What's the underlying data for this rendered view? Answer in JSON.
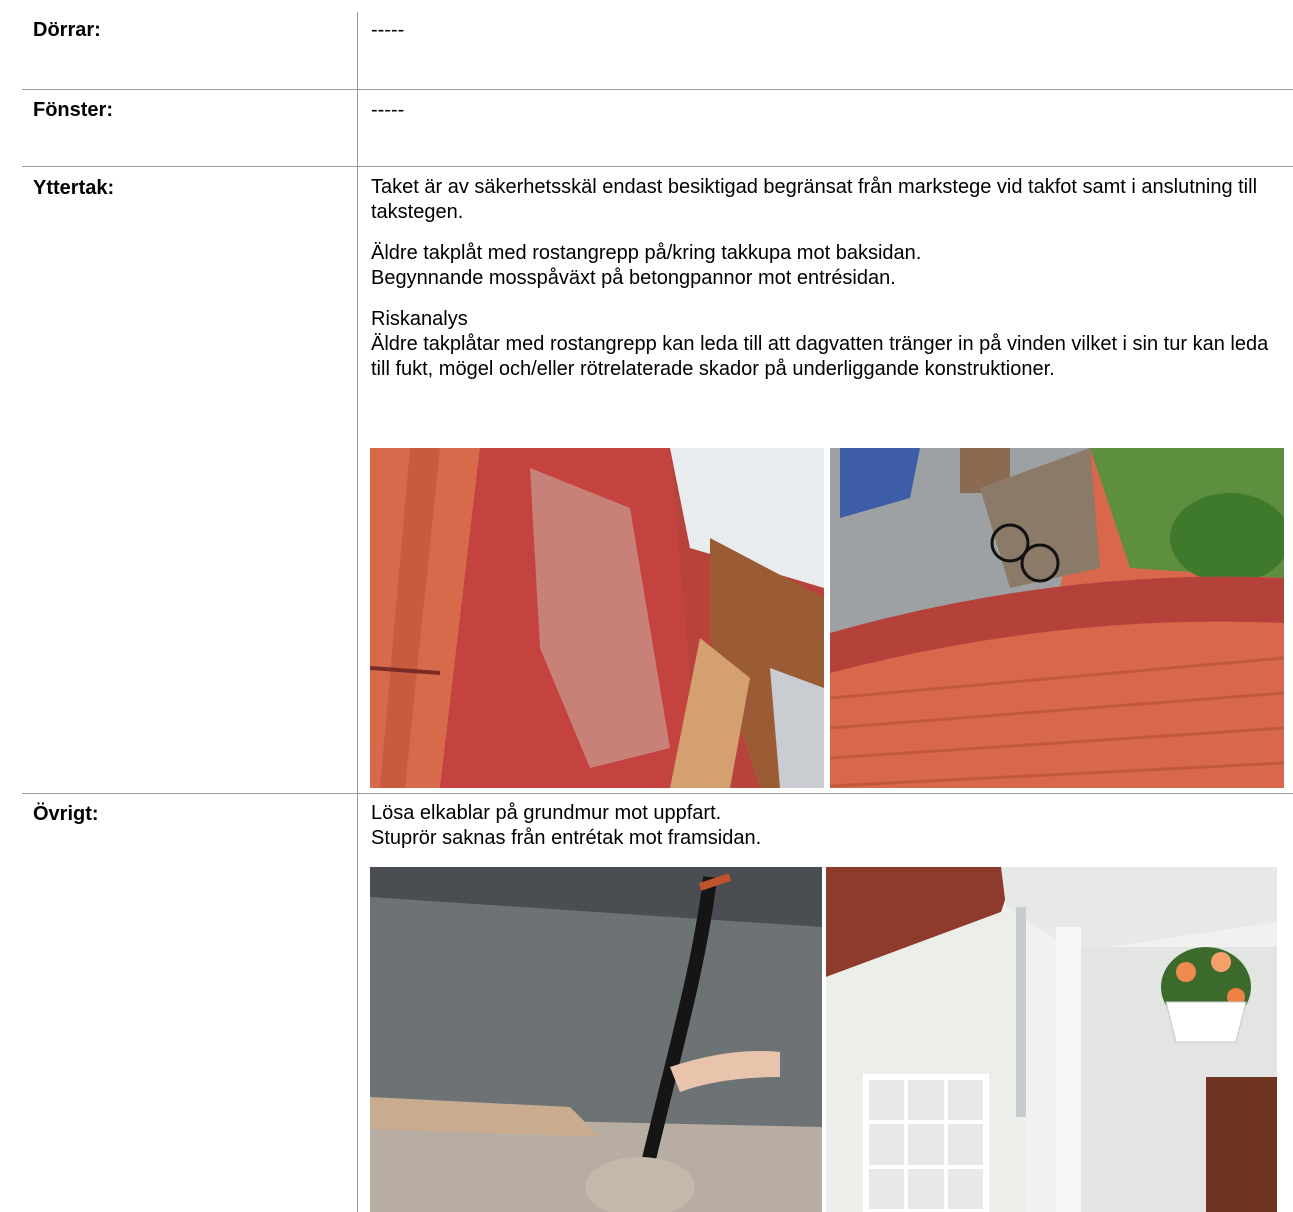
{
  "rows": [
    {
      "label": "Dörrar:",
      "text": "-----"
    },
    {
      "label": "Fönster:",
      "text": "-----"
    },
    {
      "label": "Yttertak:",
      "para1": "Taket är av säkerhetsskäl endast besiktigad begränsat från markstege vid takfot samt i anslutning till takstegen.",
      "para2_line1": "Äldre takplåt med rostangrepp på/kring takkupa mot baksidan.",
      "para2_line2": "Begynnande mosspåväxt på betongpannor mot entrésidan.",
      "para3_heading": "Riskanalys",
      "para3_body": "Äldre takplåtar med rostangrepp kan leda till att dagvatten tränger in på vinden vilket i sin tur kan leda till fukt, mögel och/eller rötrelaterade skador på underliggande konstruktioner."
    },
    {
      "label": "Övrigt:",
      "line1": "Lösa elkablar på grundmur mot uppfart.",
      "line2": "Stuprör saknas från entrétak mot framsidan."
    }
  ],
  "colors": {
    "rule": "#999999",
    "roof_red": "#c9453f",
    "tile": "#d8674b"
  }
}
